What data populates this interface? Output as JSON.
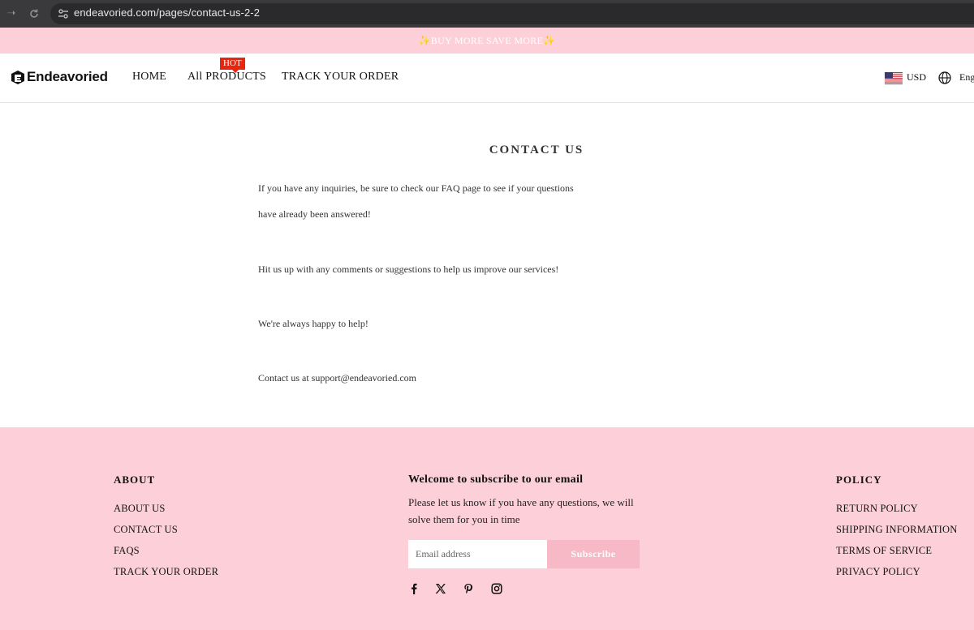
{
  "browser": {
    "url": "endeavoried.com/pages/contact-us-2-2",
    "forward_icon": "arrow-right",
    "reload_icon": "reload"
  },
  "announcement": {
    "text": "BUY MORE SAVE MORE",
    "spark_left": "✨",
    "spark_right": "✨"
  },
  "header": {
    "logo_text": "Endeavoried",
    "nav": {
      "home": "HOME",
      "products": "All PRODUCTS",
      "track": "TRACK YOUR ORDER"
    },
    "hot_badge": "HOT",
    "currency": "USD",
    "language": "Eng"
  },
  "main": {
    "title": "CONTACT US",
    "paragraphs": [
      "If you have any inquiries, be sure to check our FAQ page to see if your questions have already been answered!",
      "Hit us up with any comments or suggestions to help us improve our services!",
      "We're always happy to help!",
      "Contact us at support@endeavoried.com"
    ]
  },
  "footer": {
    "about": {
      "heading": "ABOUT",
      "links": [
        "ABOUT US",
        "CONTACT US",
        "FAQS",
        "TRACK YOUR ORDER"
      ]
    },
    "subscribe": {
      "title": "Welcome to subscribe to our email",
      "description": "Please let us know if you have any questions, we will solve them for you in time",
      "email_placeholder": "Email address",
      "button_label": "Subscribe"
    },
    "policy": {
      "heading": "POLICY",
      "links": [
        "RETURN POLICY",
        "SHIPPING INFORMATION",
        "TERMS OF SERVICE",
        "PRIVACY POLICY"
      ]
    },
    "social_icons": [
      "facebook-icon",
      "x-icon",
      "pinterest-icon",
      "instagram-icon"
    ]
  },
  "colors": {
    "pink": "#fdd0d9",
    "subscribe_button": "#f6b9c5",
    "hot_badge": "#e8260f"
  }
}
